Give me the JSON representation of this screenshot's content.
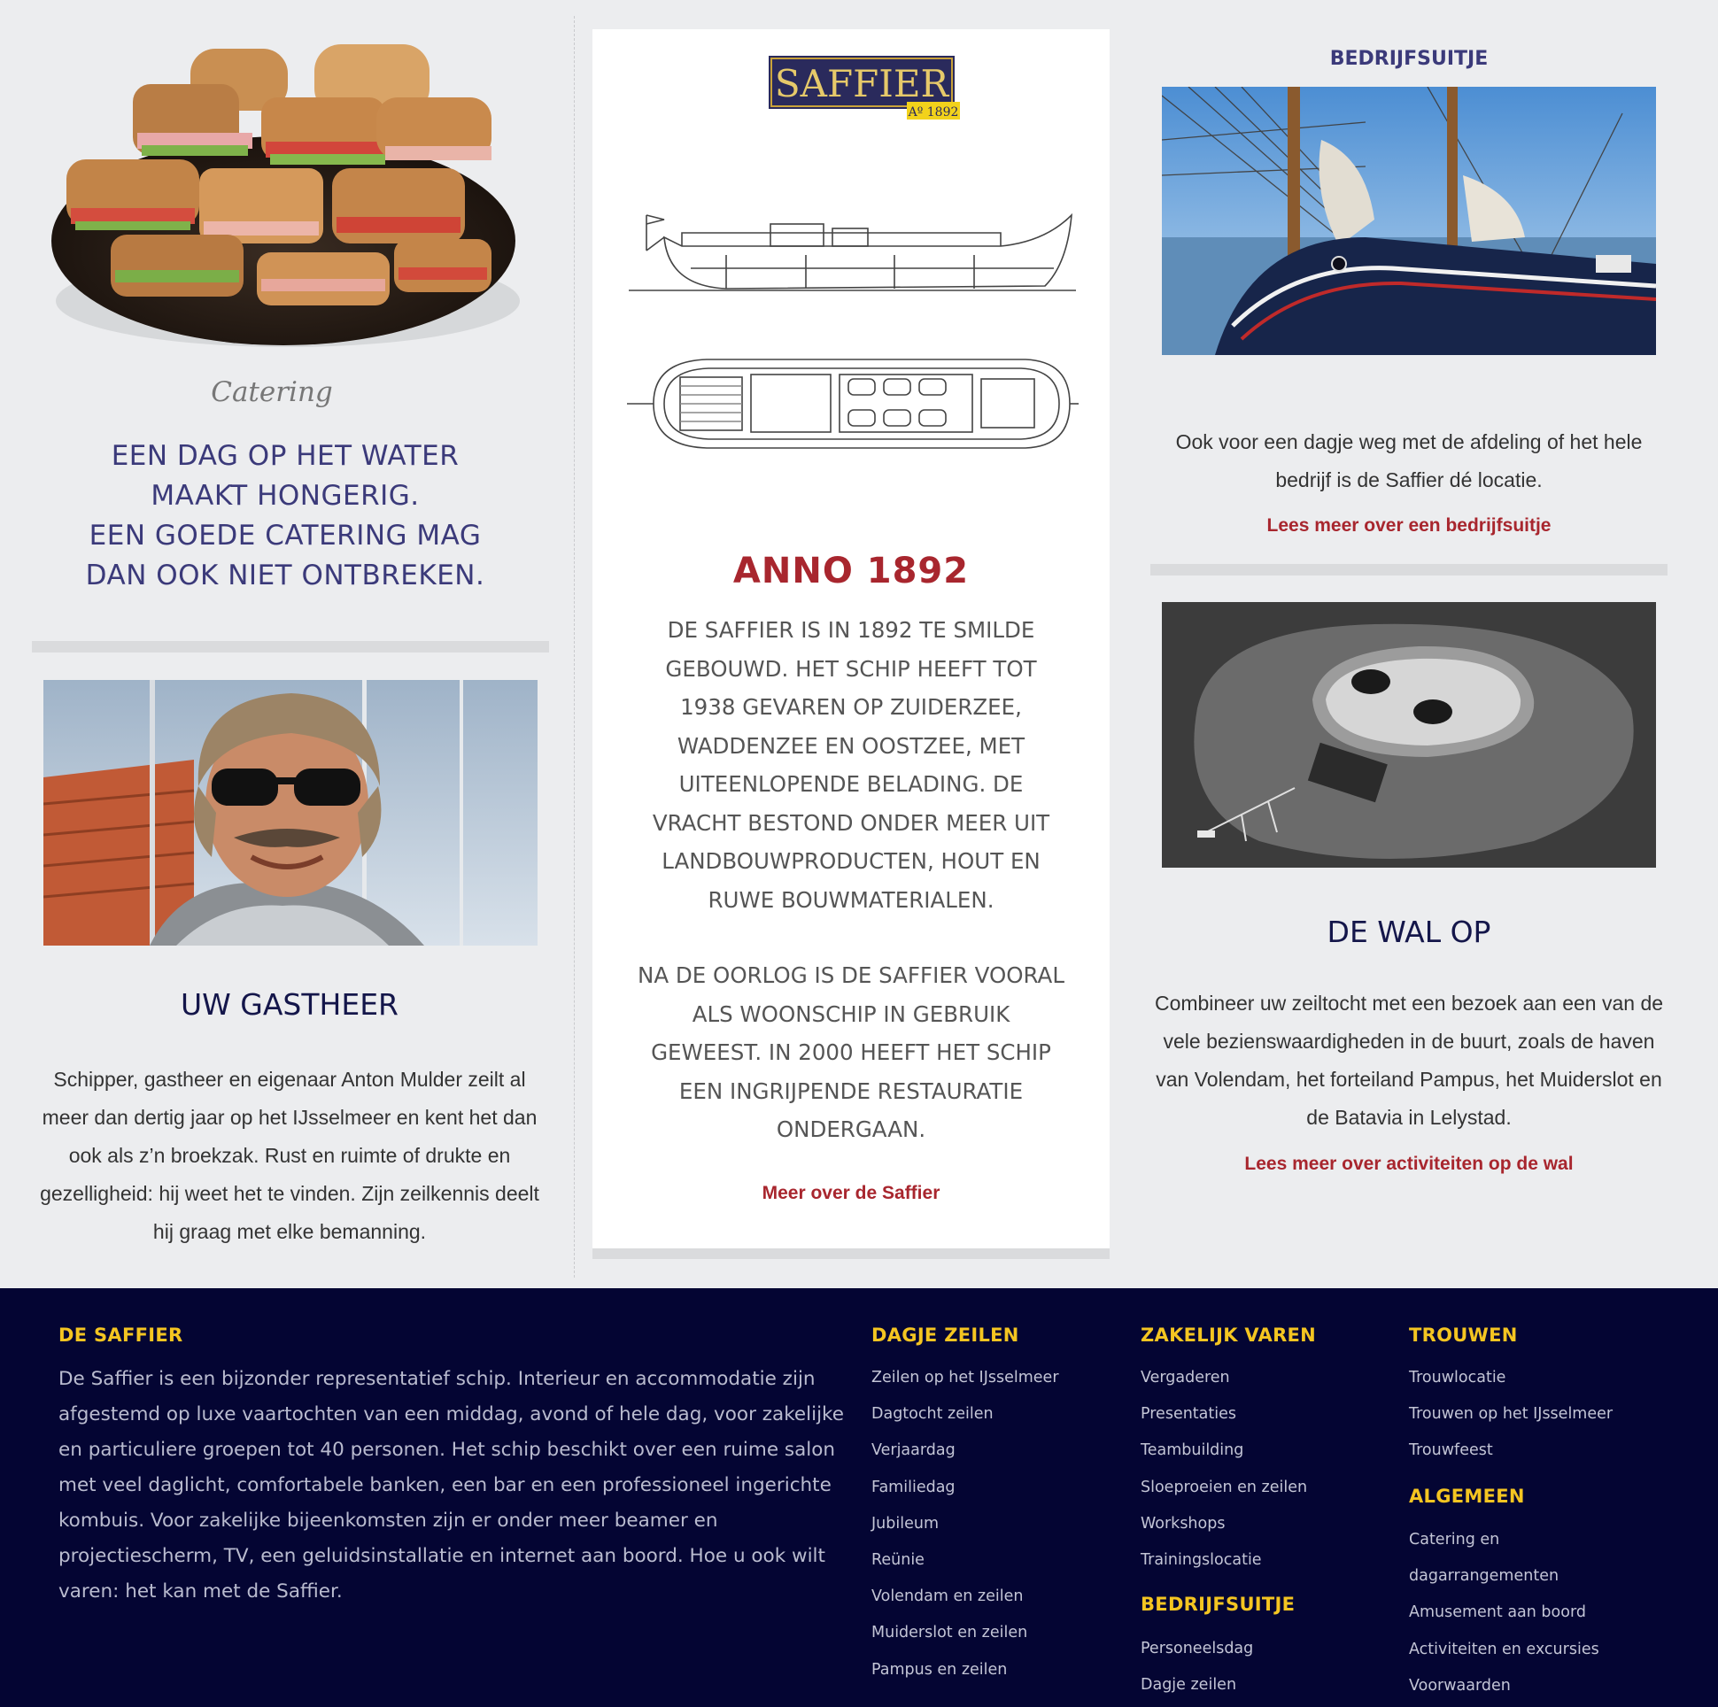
{
  "catering": {
    "script_label": "Catering",
    "heading_lines": [
      "EEN DAG OP HET WATER",
      "MAAKT HONGERIG.",
      "EEN GOEDE CATERING MAG",
      "DAN OOK NIET ONTBREKEN."
    ]
  },
  "host": {
    "title": "UW GASTHEER",
    "text": "Schipper, gastheer en eigenaar Anton Mulder zeilt al meer dan dertig jaar op het IJsselmeer en kent het dan ook als z’n broekzak. Rust en ruimte of drukte en gezelligheid: hij weet het te vinden. Zijn zeilkennis deelt hij graag met elke bemanning."
  },
  "about_ship": {
    "logo_text": "SAFFIER",
    "logo_sub": "Aº 1892",
    "anno_title": "ANNO 1892",
    "paragraph_1": "DE SAFFIER IS IN 1892 TE SMILDE GEBOUWD. HET SCHIP HEEFT TOT 1938 GEVAREN OP ZUIDERZEE, WADDENZEE EN OOSTZEE, MET UITEENLOPENDE BELADING. DE VRACHT BESTOND ONDER MEER UIT LANDBOUWPRODUCTEN, HOUT EN RUWE BOUWMATERIALEN.",
    "paragraph_2": "NA DE OORLOG IS DE SAFFIER VOORAL ALS WOONSCHIP IN GEBRUIK GEWEEST. IN 2000 HEEFT HET SCHIP EEN INGRIJPENDE RESTAURATIE ONDERGAAN.",
    "link": "Meer over de Saffier"
  },
  "company_trip": {
    "heading": "BEDRIJFSUITJE",
    "text": "Ook voor een dagje weg met de afdeling of het hele bedrijf is de Saffier dé locatie.",
    "link": "Lees meer over een bedrijfsuitje"
  },
  "ashore": {
    "title": "DE WAL OP",
    "text": "Combineer uw zeiltocht met een bezoek aan een van de vele bezienswaardigheden in de buurt, zoals de haven van Volendam, het forteiland Pampus, het Muiderslot en de Batavia in Lelystad.",
    "link": "Lees meer over activiteiten op de wal"
  },
  "footer": {
    "about_heading": "DE SAFFIER",
    "about_text": "De Saffier is een bijzonder representatief schip. Interieur en accommodatie zijn afgestemd op luxe vaartochten van een middag, avond of hele dag, voor zakelijke en particuliere groepen tot 40 personen. Het schip beschikt over een ruime salon met veel daglicht, comfortabele banken, een bar en een professioneel ingerichte kombuis. Voor zakelijke bijeenkomsten zijn er onder meer beamer en projectiescherm, TV, een geluidsinstallatie en internet aan boord. Hoe u ook wilt varen: het kan met de Saffier.",
    "dagje_heading": "DAGJE ZEILEN",
    "dagje_items": [
      "Zeilen op het IJsselmeer",
      "Dagtocht zeilen",
      "Verjaardag",
      "Familiedag",
      "Jubileum",
      "Reünie",
      "Volendam en zeilen",
      "Muiderslot en zeilen",
      "Pampus en zeilen"
    ],
    "zakelijk_heading": "ZAKELIJK VAREN",
    "zakelijk_items": [
      "Vergaderen",
      "Presentaties",
      "Teambuilding",
      "Sloeproeien en zeilen",
      "Workshops",
      "Trainingslocatie"
    ],
    "bedrijfsuitje_heading": "BEDRIJFSUITJE",
    "bedrijfsuitje_items": [
      "Personeelsdag",
      "Dagje zeilen"
    ],
    "trouwen_heading": "TROUWEN",
    "trouwen_items": [
      "Trouwlocatie",
      "Trouwen op het IJsselmeer",
      "Trouwfeest"
    ],
    "algemeen_heading": "ALGEMEEN",
    "algemeen_items": [
      "Catering en",
      "dagarrangementen",
      "Amusement aan boord",
      "Activiteiten en excursies",
      "Voorwaarden"
    ]
  }
}
